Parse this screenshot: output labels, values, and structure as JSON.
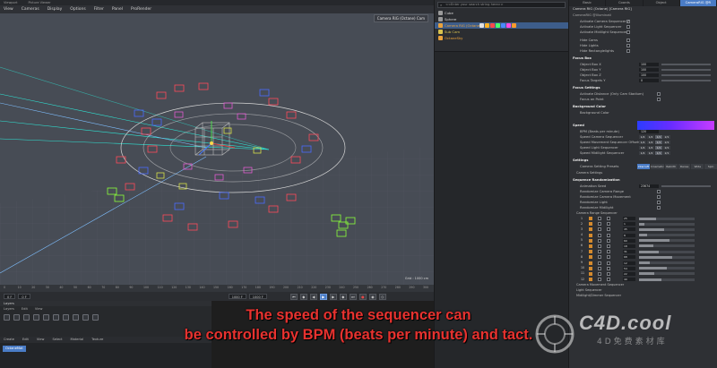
{
  "viewport": {
    "tabs": [
      "Viewport",
      "Picture Viewer"
    ],
    "menu": [
      "View",
      "Cameras",
      "Display",
      "Options",
      "Filter",
      "Panel",
      "ProRender"
    ],
    "camera_label": "Camera RIG (Octane) Cam",
    "grid_label": "Grid : 1000 cm"
  },
  "timeline": {
    "ticks": [
      "0",
      "10",
      "20",
      "30",
      "40",
      "50",
      "60",
      "70",
      "80",
      "90",
      "100",
      "110",
      "120",
      "130",
      "140",
      "150",
      "160",
      "170",
      "180",
      "190",
      "200",
      "210",
      "220",
      "230",
      "240",
      "250",
      "260",
      "270",
      "280",
      "290",
      "300"
    ],
    "start_field": "0 F",
    "mid_field": "0 F",
    "end_field": "1000 F",
    "end_field2": "1000 F"
  },
  "layers": {
    "title": "Layers",
    "tabs": [
      "Layers",
      "Edit",
      "View"
    ]
  },
  "materials": {
    "menu": [
      "Create",
      "Edit",
      "View",
      "Select",
      "Material",
      "Texture"
    ],
    "chip": "OctaneMat"
  },
  "subtitle": {
    "line1": "The speed of the sequencer can",
    "line2": "be controlled by BPM (beats per minute) and tact."
  },
  "watermark": {
    "brand": "C4D.cool",
    "sub": "4D免费素材库"
  },
  "object_manager": {
    "search_placeholder": "<<Enter your search string here>>",
    "objects": [
      {
        "name": "Cube",
        "color": "#9a9a9a",
        "style": ""
      },
      {
        "name": "Sphere",
        "color": "#9a9a9a",
        "style": ""
      },
      {
        "name": "Camera RIG (Octane)",
        "color": "#e9a13b",
        "style": "orange",
        "selected": true
      },
      {
        "name": "Sub Cam",
        "color": "#d8c24e",
        "style": "yellow"
      },
      {
        "name": "OctaneSky",
        "color": "#e9a13b",
        "style": "orange"
      }
    ]
  },
  "attributes": {
    "tabs": [
      "Basic",
      "Coords",
      "Object",
      "CameraRIG @R"
    ],
    "object_name": "Camera RIG (Octane) [Camera RIG]",
    "version": "CameraRIG @Illuminati",
    "activate": [
      {
        "label": "Activate Camera Sequencer",
        "checked": true
      },
      {
        "label": "Activate Light Sequencer",
        "checked": false
      },
      {
        "label": "Activate Midilight Sequencer",
        "checked": false
      }
    ],
    "hide": [
      {
        "label": "Hide Cams",
        "checked": false
      },
      {
        "label": "Hide Lights",
        "checked": false
      },
      {
        "label": "Hide Rectanglelights",
        "checked": false
      }
    ],
    "focus_box_title": "Focus Box",
    "focus_box": [
      {
        "label": "Object Box X",
        "value": "100"
      },
      {
        "label": "Object Box Y",
        "value": "100"
      },
      {
        "label": "Object Box Z",
        "value": "100"
      },
      {
        "label": "Focus Targets Y",
        "value": "0"
      }
    ],
    "focus_settings_title": "Focus Settings",
    "focus_settings": [
      {
        "label": "Activate Distance (Only Cam Stadium)",
        "checked": false
      },
      {
        "label": "Focus on Point",
        "checked": false
      }
    ],
    "bg_color_title": "Background Color",
    "bg_color_label": "Background Color",
    "speed_title": "Speed",
    "speed": [
      {
        "label": "BPM (Beats per minute)",
        "value": "120"
      },
      {
        "label": "Speed Camera Sequencer",
        "chips": [
          "1/4",
          "1/2",
          "1/1",
          "2/1"
        ]
      },
      {
        "label": "Speed Movement Sequencer Offsets",
        "chips": [
          "1/4",
          "1/2",
          "1/1",
          "2/1"
        ]
      },
      {
        "label": "Speed Light Sequencer",
        "chips": [
          "1/4",
          "1/2",
          "1/1",
          "2/1"
        ]
      },
      {
        "label": "Speed Midilight Sequencer",
        "chips": [
          "1/4",
          "1/2",
          "1/1",
          "2/1"
        ]
      }
    ],
    "settings_title": "Settings",
    "preset_label": "Camera Setting Presets",
    "presets": [
      "Interruft",
      "Cinematic",
      "Rebirth",
      "Dense",
      "Wide",
      "Spin"
    ],
    "camera_settings": "Camera Settings",
    "randomization_title": "Sequence Randomization",
    "randomization": [
      {
        "label": "Animation Seed",
        "value": "23674"
      },
      {
        "label": "Randomize Camera Range",
        "checked": false
      },
      {
        "label": "Randomize Camera Movement",
        "checked": false
      },
      {
        "label": "Randomize Light",
        "checked": false
      },
      {
        "label": "Randomize Midilight",
        "checked": false
      }
    ],
    "range_seq_title": "Camera Range Sequencer",
    "sequence": [
      {
        "n": "1",
        "v": "25",
        "fill": 0.3
      },
      {
        "n": "2",
        "v": "1",
        "fill": 0.1
      },
      {
        "n": "3",
        "v": "45",
        "fill": 0.45
      },
      {
        "n": "4",
        "v": "8",
        "fill": 0.15
      },
      {
        "n": "5",
        "v": "60",
        "fill": 0.55
      },
      {
        "n": "6",
        "v": "18",
        "fill": 0.25
      },
      {
        "n": "7",
        "v": "31",
        "fill": 0.35
      },
      {
        "n": "8",
        "v": "68",
        "fill": 0.6
      },
      {
        "n": "9",
        "v": "12",
        "fill": 0.2
      },
      {
        "n": "10",
        "v": "54",
        "fill": 0.5
      },
      {
        "n": "11",
        "v": "22",
        "fill": 0.28
      },
      {
        "n": "12",
        "v": "40",
        "fill": 0.4
      }
    ],
    "collapsed": [
      "Camera Movement Sequencer",
      "Light Sequencer",
      "Midilight/Dimmer Sequencer"
    ]
  }
}
